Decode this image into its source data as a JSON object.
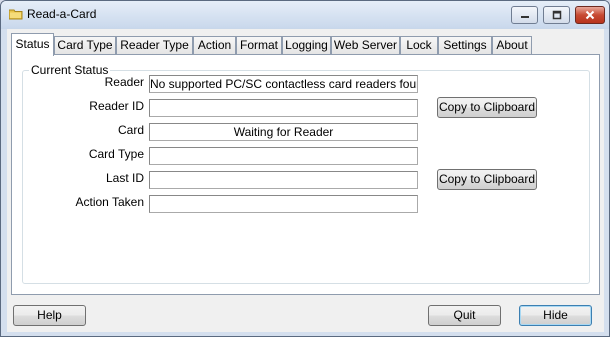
{
  "window": {
    "title": "Read-a-Card",
    "icon": "folder-card-icon",
    "controls": {
      "minimize": "minimize-icon",
      "maximize": "maximize-icon",
      "close": "close-icon"
    }
  },
  "tabs": [
    {
      "label": "Status",
      "active": true
    },
    {
      "label": "Card Type",
      "active": false
    },
    {
      "label": "Reader Type",
      "active": false
    },
    {
      "label": "Action",
      "active": false
    },
    {
      "label": "Format",
      "active": false
    },
    {
      "label": "Logging",
      "active": false
    },
    {
      "label": "Web Server",
      "active": false
    },
    {
      "label": "Lock",
      "active": false
    },
    {
      "label": "Settings",
      "active": false
    },
    {
      "label": "About",
      "active": false
    }
  ],
  "status": {
    "group_label": "Current Status",
    "reader": {
      "label": "Reader",
      "value": "No supported PC/SC contactless card readers found"
    },
    "reader_id": {
      "label": "Reader ID",
      "value": ""
    },
    "card": {
      "label": "Card",
      "value": "Waiting for Reader"
    },
    "card_type": {
      "label": "Card Type",
      "value": ""
    },
    "last_id": {
      "label": "Last ID",
      "value": ""
    },
    "action_taken": {
      "label": "Action Taken",
      "value": ""
    },
    "copy_reader_id_label": "Copy to Clipboard",
    "copy_last_id_label": "Copy to Clipboard"
  },
  "footer": {
    "help_label": "Help",
    "quit_label": "Quit",
    "hide_label": "Hide"
  },
  "colors": {
    "titlebar": "#c9d8ec",
    "close_button": "#c74a33",
    "default_button_border": "#3c7fb1"
  }
}
